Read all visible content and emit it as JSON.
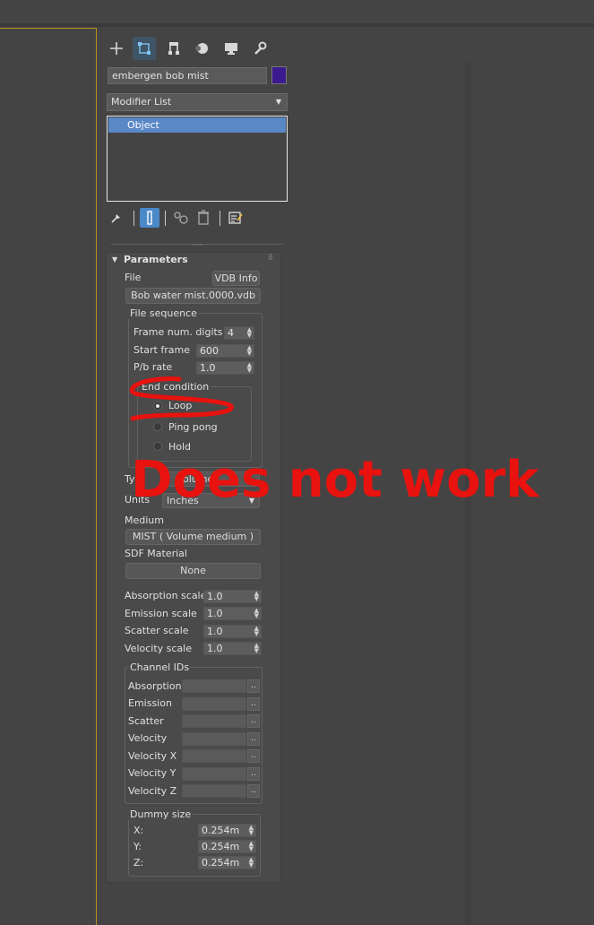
{
  "object_name": "embergen bob mist",
  "object_color": "#3b1a8f",
  "modifier_list": {
    "label": "Modifier List"
  },
  "stack": {
    "items": [
      "Object"
    ]
  },
  "parameters": {
    "title": "Parameters",
    "file_label": "File",
    "vdb_info": "VDB Info",
    "file_name": "Bob water mist.0000.vdb",
    "file_sequence": {
      "title": "File sequence",
      "frame_digits_label": "Frame num. digits",
      "frame_digits": "4",
      "start_frame_label": "Start frame",
      "start_frame": "600",
      "pb_rate_label": "P/b rate",
      "pb_rate": "1.0",
      "end_condition": {
        "title": "End condition",
        "options": [
          "Loop",
          "Ping pong",
          "Hold"
        ],
        "selected": "Loop"
      }
    },
    "type_label": "Typ",
    "type_value": "olume",
    "units_label": "Units",
    "units_value": "Inches",
    "medium_label": "Medium",
    "medium_value": "MIST  ( Volume medium )",
    "sdf_label": "SDF Material",
    "sdf_value": "None",
    "scales": [
      {
        "label": "Absorption scale",
        "value": "1.0"
      },
      {
        "label": "Emission scale",
        "value": "1.0"
      },
      {
        "label": "Scatter scale",
        "value": "1.0"
      },
      {
        "label": "Velocity scale",
        "value": "1.0"
      }
    ],
    "channel_ids": {
      "title": "Channel IDs",
      "rows": [
        "Absorption",
        "Emission",
        "Scatter",
        "Velocity",
        "Velocity X",
        "Velocity Y",
        "Velocity Z"
      ],
      "btn": ".."
    },
    "dummy_size": {
      "title": "Dummy size",
      "rows": [
        {
          "label": "X:",
          "value": "0.254m"
        },
        {
          "label": "Y:",
          "value": "0.254m"
        },
        {
          "label": "Z:",
          "value": "0.254m"
        }
      ]
    }
  },
  "annotation": {
    "text": "Does not work",
    "color": "#e8120f"
  }
}
